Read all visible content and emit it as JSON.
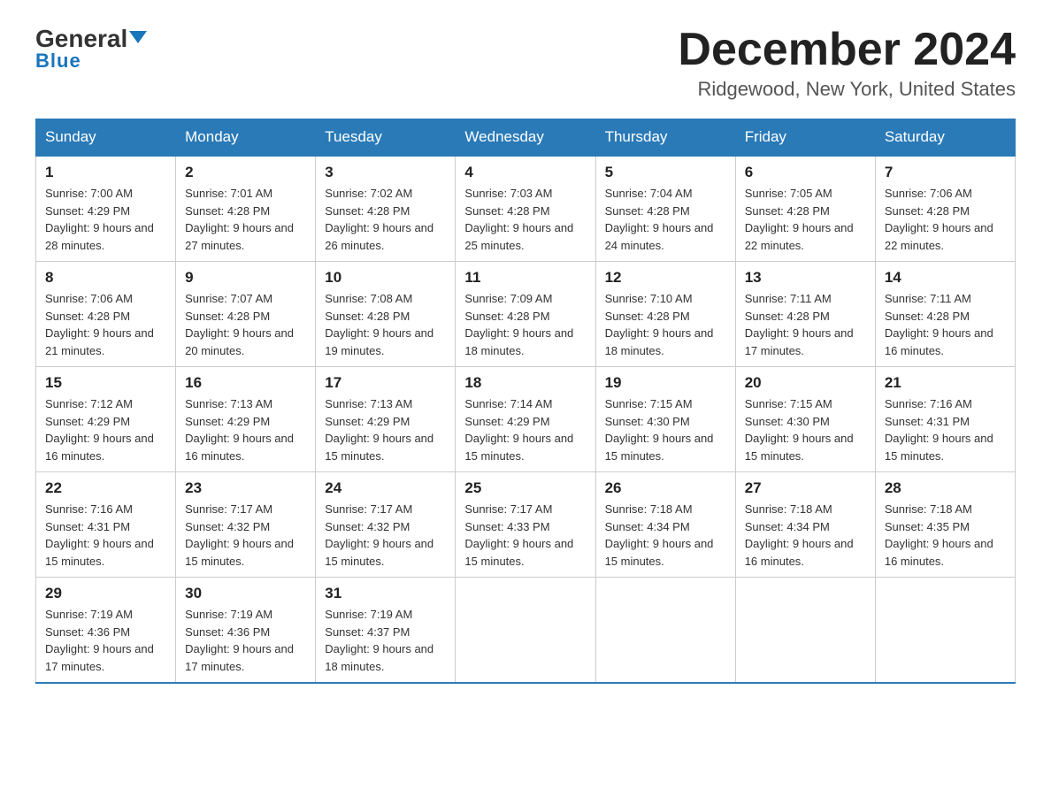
{
  "header": {
    "logo_general": "General",
    "logo_blue": "Blue",
    "month_title": "December 2024",
    "location": "Ridgewood, New York, United States"
  },
  "days_of_week": [
    "Sunday",
    "Monday",
    "Tuesday",
    "Wednesday",
    "Thursday",
    "Friday",
    "Saturday"
  ],
  "weeks": [
    [
      {
        "num": "1",
        "sunrise": "7:00 AM",
        "sunset": "4:29 PM",
        "daylight": "9 hours and 28 minutes."
      },
      {
        "num": "2",
        "sunrise": "7:01 AM",
        "sunset": "4:28 PM",
        "daylight": "9 hours and 27 minutes."
      },
      {
        "num": "3",
        "sunrise": "7:02 AM",
        "sunset": "4:28 PM",
        "daylight": "9 hours and 26 minutes."
      },
      {
        "num": "4",
        "sunrise": "7:03 AM",
        "sunset": "4:28 PM",
        "daylight": "9 hours and 25 minutes."
      },
      {
        "num": "5",
        "sunrise": "7:04 AM",
        "sunset": "4:28 PM",
        "daylight": "9 hours and 24 minutes."
      },
      {
        "num": "6",
        "sunrise": "7:05 AM",
        "sunset": "4:28 PM",
        "daylight": "9 hours and 22 minutes."
      },
      {
        "num": "7",
        "sunrise": "7:06 AM",
        "sunset": "4:28 PM",
        "daylight": "9 hours and 22 minutes."
      }
    ],
    [
      {
        "num": "8",
        "sunrise": "7:06 AM",
        "sunset": "4:28 PM",
        "daylight": "9 hours and 21 minutes."
      },
      {
        "num": "9",
        "sunrise": "7:07 AM",
        "sunset": "4:28 PM",
        "daylight": "9 hours and 20 minutes."
      },
      {
        "num": "10",
        "sunrise": "7:08 AM",
        "sunset": "4:28 PM",
        "daylight": "9 hours and 19 minutes."
      },
      {
        "num": "11",
        "sunrise": "7:09 AM",
        "sunset": "4:28 PM",
        "daylight": "9 hours and 18 minutes."
      },
      {
        "num": "12",
        "sunrise": "7:10 AM",
        "sunset": "4:28 PM",
        "daylight": "9 hours and 18 minutes."
      },
      {
        "num": "13",
        "sunrise": "7:11 AM",
        "sunset": "4:28 PM",
        "daylight": "9 hours and 17 minutes."
      },
      {
        "num": "14",
        "sunrise": "7:11 AM",
        "sunset": "4:28 PM",
        "daylight": "9 hours and 16 minutes."
      }
    ],
    [
      {
        "num": "15",
        "sunrise": "7:12 AM",
        "sunset": "4:29 PM",
        "daylight": "9 hours and 16 minutes."
      },
      {
        "num": "16",
        "sunrise": "7:13 AM",
        "sunset": "4:29 PM",
        "daylight": "9 hours and 16 minutes."
      },
      {
        "num": "17",
        "sunrise": "7:13 AM",
        "sunset": "4:29 PM",
        "daylight": "9 hours and 15 minutes."
      },
      {
        "num": "18",
        "sunrise": "7:14 AM",
        "sunset": "4:29 PM",
        "daylight": "9 hours and 15 minutes."
      },
      {
        "num": "19",
        "sunrise": "7:15 AM",
        "sunset": "4:30 PM",
        "daylight": "9 hours and 15 minutes."
      },
      {
        "num": "20",
        "sunrise": "7:15 AM",
        "sunset": "4:30 PM",
        "daylight": "9 hours and 15 minutes."
      },
      {
        "num": "21",
        "sunrise": "7:16 AM",
        "sunset": "4:31 PM",
        "daylight": "9 hours and 15 minutes."
      }
    ],
    [
      {
        "num": "22",
        "sunrise": "7:16 AM",
        "sunset": "4:31 PM",
        "daylight": "9 hours and 15 minutes."
      },
      {
        "num": "23",
        "sunrise": "7:17 AM",
        "sunset": "4:32 PM",
        "daylight": "9 hours and 15 minutes."
      },
      {
        "num": "24",
        "sunrise": "7:17 AM",
        "sunset": "4:32 PM",
        "daylight": "9 hours and 15 minutes."
      },
      {
        "num": "25",
        "sunrise": "7:17 AM",
        "sunset": "4:33 PM",
        "daylight": "9 hours and 15 minutes."
      },
      {
        "num": "26",
        "sunrise": "7:18 AM",
        "sunset": "4:34 PM",
        "daylight": "9 hours and 15 minutes."
      },
      {
        "num": "27",
        "sunrise": "7:18 AM",
        "sunset": "4:34 PM",
        "daylight": "9 hours and 16 minutes."
      },
      {
        "num": "28",
        "sunrise": "7:18 AM",
        "sunset": "4:35 PM",
        "daylight": "9 hours and 16 minutes."
      }
    ],
    [
      {
        "num": "29",
        "sunrise": "7:19 AM",
        "sunset": "4:36 PM",
        "daylight": "9 hours and 17 minutes."
      },
      {
        "num": "30",
        "sunrise": "7:19 AM",
        "sunset": "4:36 PM",
        "daylight": "9 hours and 17 minutes."
      },
      {
        "num": "31",
        "sunrise": "7:19 AM",
        "sunset": "4:37 PM",
        "daylight": "9 hours and 18 minutes."
      },
      null,
      null,
      null,
      null
    ]
  ]
}
